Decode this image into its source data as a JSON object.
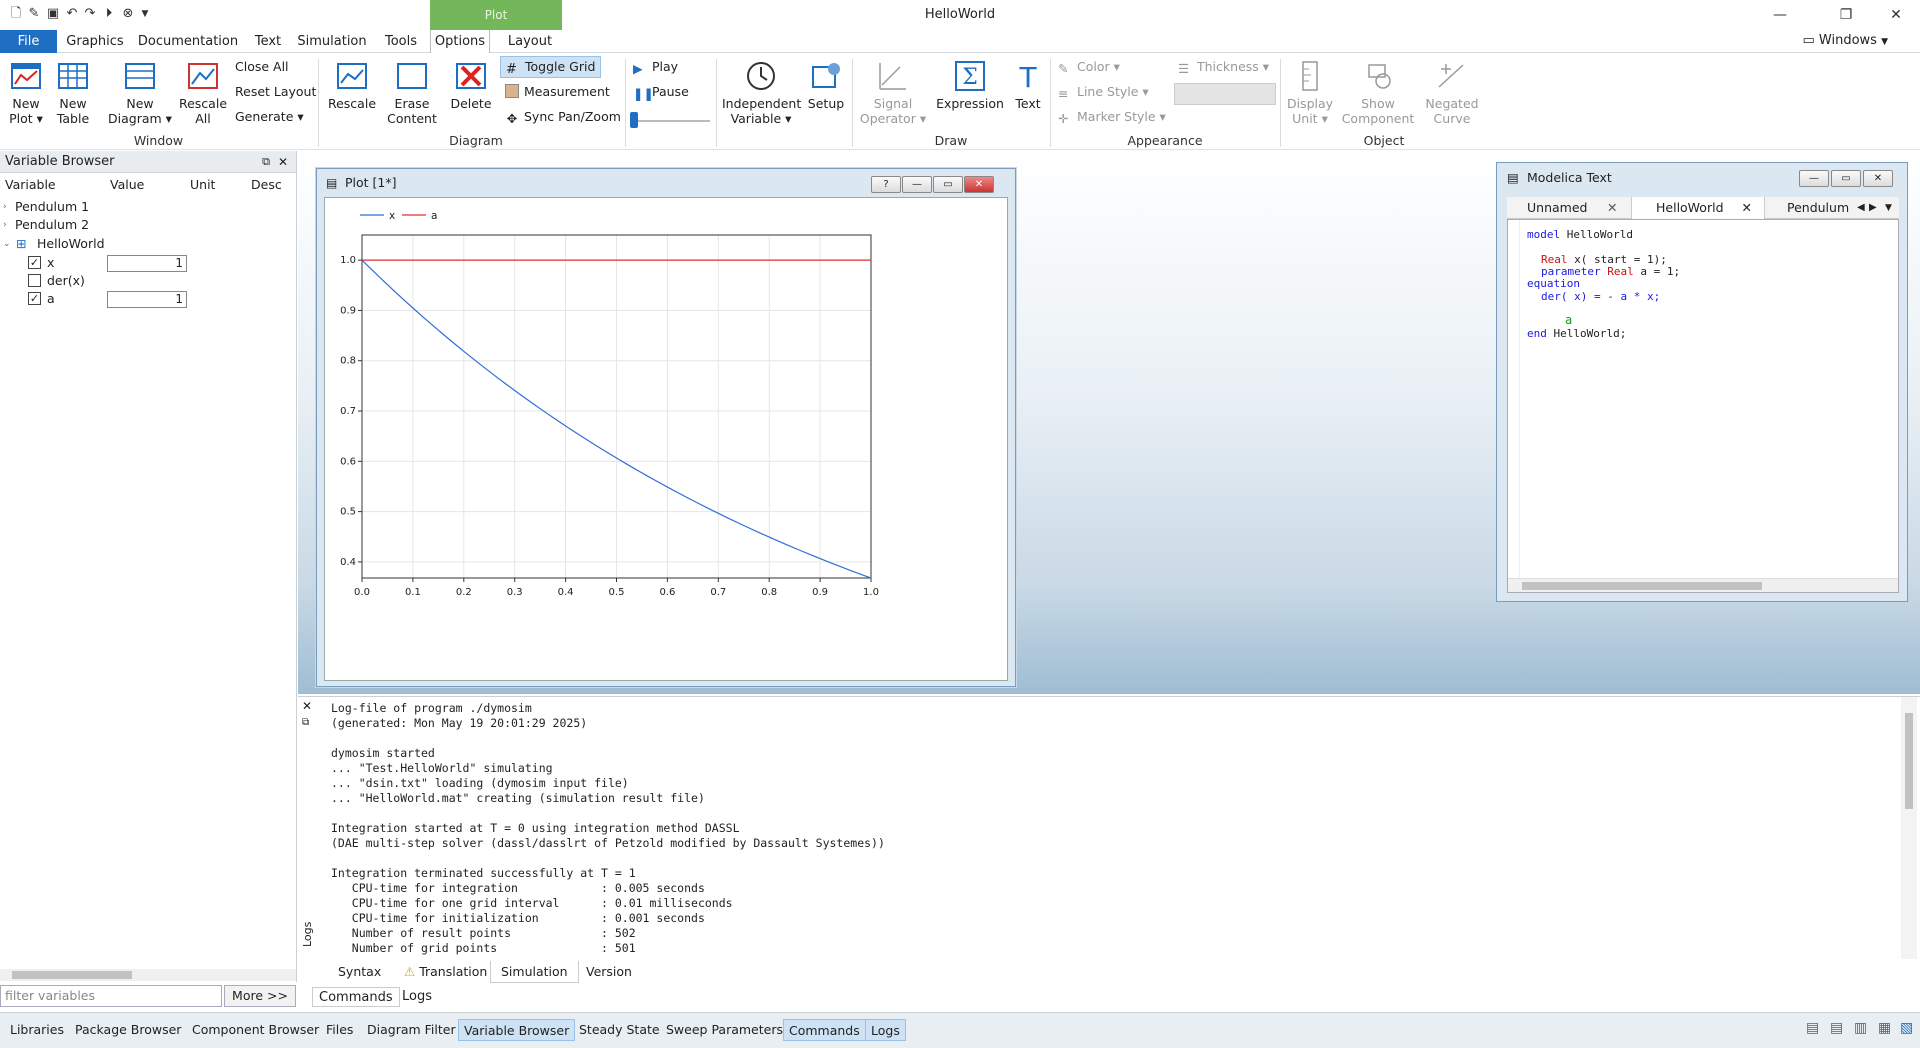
{
  "app": {
    "title": "HelloWorld",
    "context_tab": "Plot",
    "windows_label": "Windows"
  },
  "menu": {
    "tabs": [
      "File",
      "Graphics",
      "Documentation",
      "Text",
      "Simulation",
      "Tools",
      "Options",
      "Layout"
    ]
  },
  "ribbon": {
    "new_plot": "New",
    "new_plot2": "Plot",
    "new_table": "New",
    "new_table2": "Table",
    "new_diagram": "New",
    "new_diagram2": "Diagram",
    "rescale_all": "Rescale",
    "rescale_all2": "All",
    "close_all": "Close All",
    "reset_layout": "Reset Layout",
    "generate": "Generate",
    "rescale": "Rescale",
    "erase": "Erase",
    "erase2": "Content",
    "delete": "Delete",
    "toggle_grid": "Toggle Grid",
    "measurement": "Measurement",
    "sync": "Sync Pan/Zoom",
    "play": "Play",
    "pause": "Pause",
    "indep": "Independent",
    "indep2": "Variable",
    "setup": "Setup",
    "signal": "Signal",
    "signal2": "Operator",
    "expression": "Expression",
    "text": "Text",
    "color": "Color",
    "line_style": "Line Style",
    "marker_style": "Marker Style",
    "thickness": "Thickness",
    "display_unit": "Display",
    "display_unit2": "Unit",
    "show_comp": "Show",
    "show_comp2": "Component",
    "negated": "Negated",
    "negated2": "Curve",
    "groups": {
      "window": "Window",
      "diagram": "Diagram",
      "draw": "Draw",
      "appearance": "Appearance",
      "object": "Object"
    }
  },
  "variable_browser": {
    "title": "Variable Browser",
    "columns": [
      "Variable",
      "Value",
      "Unit",
      "Desc"
    ],
    "items": [
      {
        "label": "Pendulum 1"
      },
      {
        "label": "Pendulum 2"
      },
      {
        "label": "HelloWorld"
      },
      {
        "label": "x",
        "value": "1",
        "checked": true
      },
      {
        "label": "der(x)",
        "checked": false
      },
      {
        "label": "a",
        "value": "1",
        "checked": true
      }
    ],
    "filter_placeholder": "filter variables",
    "more": "More >>"
  },
  "plot": {
    "title": "Plot [1*]"
  },
  "chart_data": {
    "type": "line",
    "title": "",
    "xlabel": "",
    "ylabel": "",
    "xlim": [
      0,
      1
    ],
    "ylim": [
      0.368,
      1.05
    ],
    "xticks": [
      "0.0",
      "0.1",
      "0.2",
      "0.3",
      "0.4",
      "0.5",
      "0.6",
      "0.7",
      "0.8",
      "0.9",
      "1.0"
    ],
    "yticks": [
      "0.4",
      "0.5",
      "0.6",
      "0.7",
      "0.8",
      "0.9",
      "1.0"
    ],
    "grid": true,
    "legend": "top-left",
    "series": [
      {
        "name": "x",
        "color": "#2f6fd6",
        "x": [
          0,
          0.1,
          0.2,
          0.3,
          0.4,
          0.5,
          0.6,
          0.7,
          0.8,
          0.9,
          1.0
        ],
        "y": [
          1.0,
          0.905,
          0.819,
          0.741,
          0.67,
          0.607,
          0.549,
          0.497,
          0.449,
          0.407,
          0.368
        ]
      },
      {
        "name": "a",
        "color": "#e03030",
        "x": [
          0,
          1.0
        ],
        "y": [
          1.0,
          1.0
        ]
      }
    ]
  },
  "modelica": {
    "title": "Modelica Text",
    "tabs": [
      "Unnamed",
      "HelloWorld",
      "Pendulum"
    ],
    "code": {
      "l1a": "model",
      "l1b": " HelloWorld",
      "l2a": "Real",
      "l2b": " x( start = 1);",
      "l3a": "parameter",
      "l3b": "Real",
      "l3c": " a = 1;",
      "l4": "equation",
      "l5": "der( x) = - a * x;",
      "l6": "a",
      "l7a": "end",
      "l7b": " HelloWorld;"
    }
  },
  "log": {
    "lines": [
      "Log-file of program ./dymosim",
      "(generated: Mon May 19 20:01:29 2025)",
      "",
      "dymosim started",
      "... \"Test.HelloWorld\" simulating",
      "... \"dsin.txt\" loading (dymosim input file)",
      "... \"HelloWorld.mat\" creating (simulation result file)",
      "",
      "Integration started at T = 0 using integration method DASSL",
      "(DAE multi-step solver (dassl/dasslrt of Petzold modified by Dassault Systemes))",
      "",
      "Integration terminated successfully at T = 1",
      "   CPU-time for integration            : 0.005 seconds",
      "   CPU-time for one grid interval      : 0.01 milliseconds",
      "   CPU-time for initialization         : 0.001 seconds",
      "   Number of result points             : 502",
      "   Number of grid points               : 501"
    ],
    "tabs": [
      "Syntax",
      "Translation",
      "Simulation",
      "Version"
    ],
    "side_label": "Logs"
  },
  "command_tabs": [
    "Commands",
    "Logs"
  ],
  "status_tabs": [
    "Libraries",
    "Package Browser",
    "Component Browser",
    "Files",
    "Diagram Filter",
    "Variable Browser",
    "Steady State",
    "Sweep Parameters",
    "Commands",
    "Logs"
  ]
}
